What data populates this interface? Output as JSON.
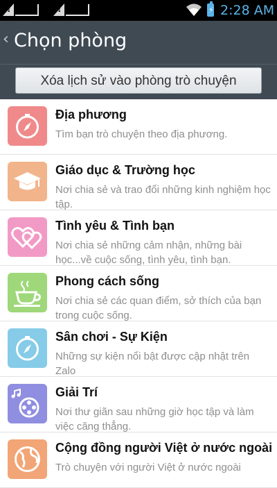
{
  "status_bar": {
    "time": "2:28 AM",
    "sim1_icon": "sim-no-signal-icon",
    "sim2_icon": "sim-no-signal-icon",
    "wifi_icon": "wifi-icon",
    "battery_icon": "battery-charging-icon",
    "battery_symbol": "⚡"
  },
  "header": {
    "back_icon": "chevron-left-icon",
    "back_glyph": "‹",
    "title": "Chọn phòng"
  },
  "clear_button": {
    "label": "Xóa lịch sử vào phòng trò chuyện"
  },
  "rooms": [
    {
      "title": "Địa phương",
      "desc": "Tìm bạn trò chuyện theo địa phương.",
      "icon": "compass-icon",
      "color": "#f08a8a"
    },
    {
      "title": "Giáo dục & Trường học",
      "desc": "Nơi chia sẻ và trao đổi những kinh nghiệm học tập.",
      "icon": "graduation-cap-icon",
      "color": "#f2b48a"
    },
    {
      "title": "Tình yêu & Tình bạn",
      "desc": "Nơi chia sẻ những cảm nhận, những bài học...về cuộc sống, tình yêu, tình bạn.",
      "icon": "hearts-icon",
      "color": "#f29ac6"
    },
    {
      "title": "Phong cách sống",
      "desc": "Nơi chia sẻ các quan điểm, sở thích của bạn trong cuộc sống.",
      "icon": "coffee-cup-icon",
      "color": "#9ed87a"
    },
    {
      "title": "Sân chơi - Sự Kiện",
      "desc": "Những sự kiện nổi bật được cập nhật trên Zalo",
      "icon": "compass-icon",
      "color": "#86cbe8"
    },
    {
      "title": "Giải Trí",
      "desc": "Nơi thư giãn sau những giờ học tập và làm việc căng thẳng.",
      "icon": "film-reel-music-icon",
      "color": "#8f8ee0"
    },
    {
      "title": "Cộng đồng người Việt ở nước ngoài",
      "desc": "Trò chuyện với người Việt ở nước ngoài",
      "icon": "globe-icon",
      "color": "#f2a576"
    }
  ]
}
